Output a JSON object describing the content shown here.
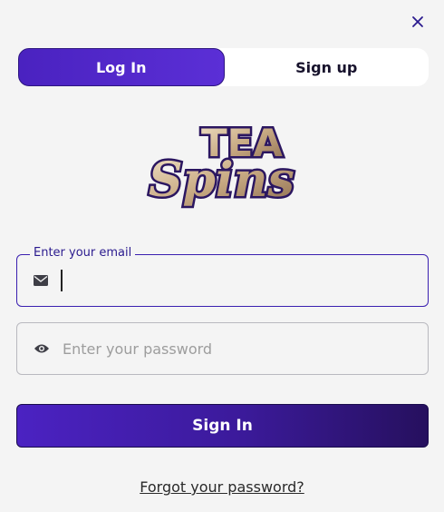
{
  "tabs": [
    {
      "label": "Log In",
      "active": true
    },
    {
      "label": "Sign up",
      "active": false
    }
  ],
  "logo": {
    "line1": "TEA",
    "line2": "Spins"
  },
  "email": {
    "label": "Enter your email",
    "value": "",
    "icon": "envelope-icon"
  },
  "password": {
    "placeholder": "Enter your password",
    "value": "",
    "icon": "eye-icon"
  },
  "signin_label": "Sign In",
  "forgot_label": "Forgot your password?",
  "colors": {
    "accent": "#4a22c0",
    "accent_dark": "#26105e",
    "background": "#f4f4f4"
  }
}
